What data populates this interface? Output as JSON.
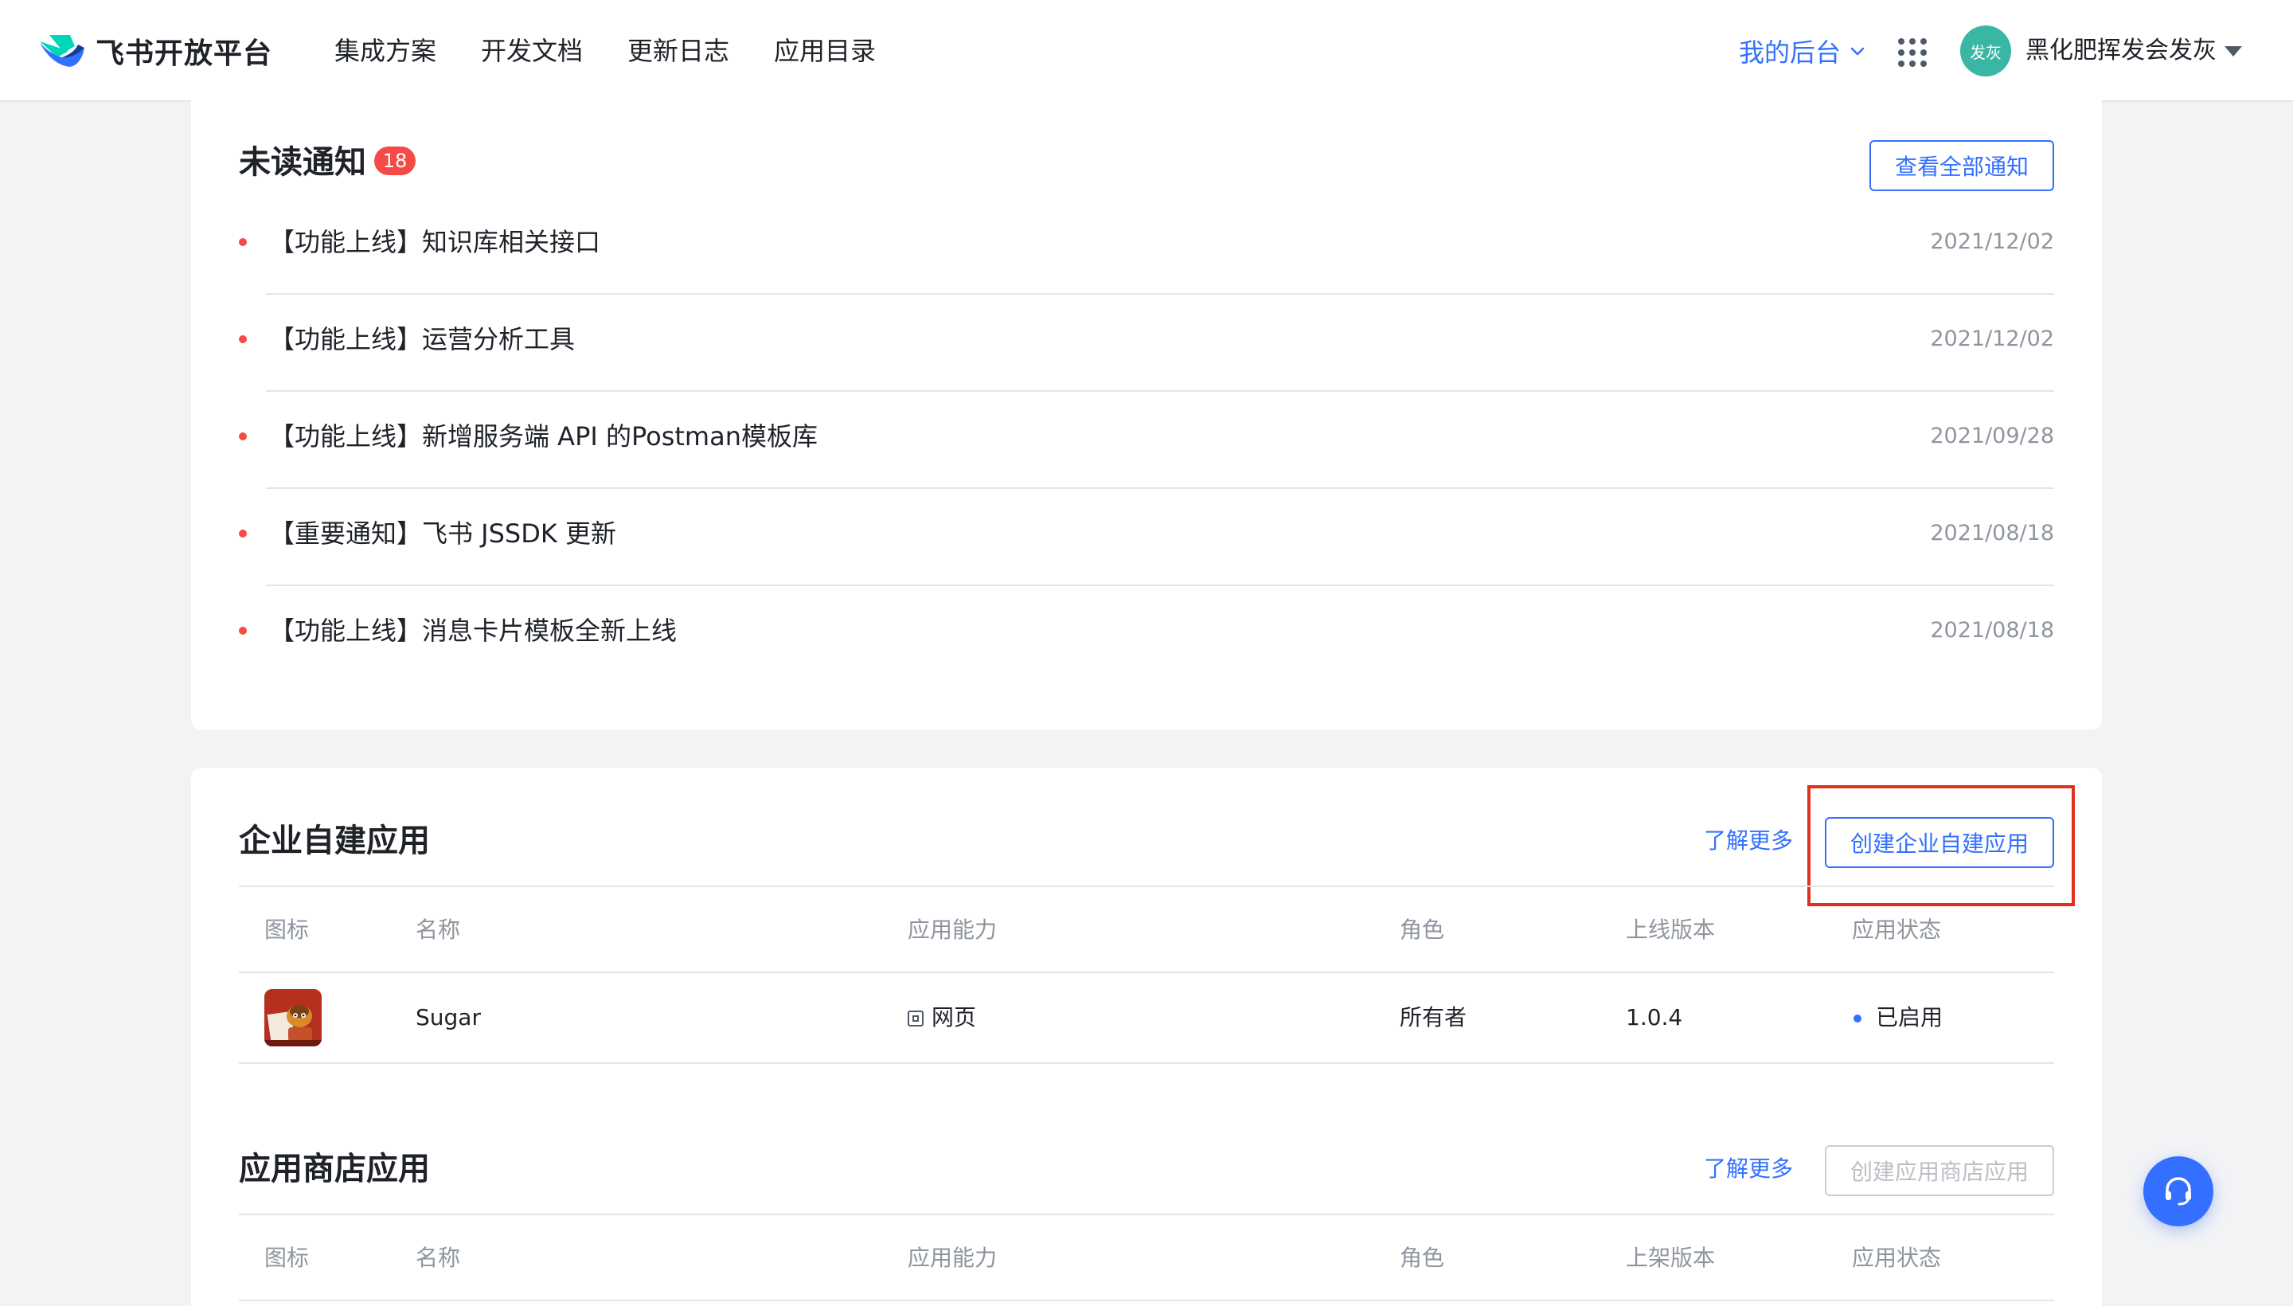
{
  "brand": {
    "name": "飞书开放平台",
    "logo_icon": "feishu-logo-icon"
  },
  "nav": {
    "links": [
      "集成方案",
      "开发文档",
      "更新日志",
      "应用目录"
    ],
    "my_console": "我的后台",
    "apps_icon": "apps-grid-icon",
    "avatar_text": "发灰",
    "username": "黑化肥挥发会发灰"
  },
  "notices": {
    "title": "未读通知",
    "unread_count": "18",
    "view_all": "查看全部通知",
    "items": [
      {
        "title": "【功能上线】知识库相关接口",
        "date": "2021/12/02"
      },
      {
        "title": "【功能上线】运营分析工具",
        "date": "2021/12/02"
      },
      {
        "title": "【功能上线】新增服务端 API 的Postman模板库",
        "date": "2021/09/28"
      },
      {
        "title": "【重要通知】飞书 JSSDK 更新",
        "date": "2021/08/18"
      },
      {
        "title": "【功能上线】消息卡片模板全新上线",
        "date": "2021/08/18"
      }
    ]
  },
  "enterprise_apps": {
    "title": "企业自建应用",
    "learn_more": "了解更多",
    "create": "创建企业自建应用",
    "columns": [
      "图标",
      "名称",
      "应用能力",
      "角色",
      "上线版本",
      "应用状态"
    ],
    "rows": [
      {
        "icon": "sugar-app-icon",
        "name": "Sugar",
        "capability": "网页",
        "role": "所有者",
        "version": "1.0.4",
        "status": "已启用"
      }
    ]
  },
  "store_apps": {
    "title": "应用商店应用",
    "learn_more": "了解更多",
    "create": "创建应用商店应用",
    "columns": [
      "图标",
      "名称",
      "应用能力",
      "角色",
      "上架版本",
      "应用状态"
    ]
  },
  "help_icon": "headset-support-icon",
  "colors": {
    "accent": "#3370ff",
    "badge": "#f54a45",
    "highlight": "#e0301e",
    "avatar": "#3ab7a4"
  }
}
